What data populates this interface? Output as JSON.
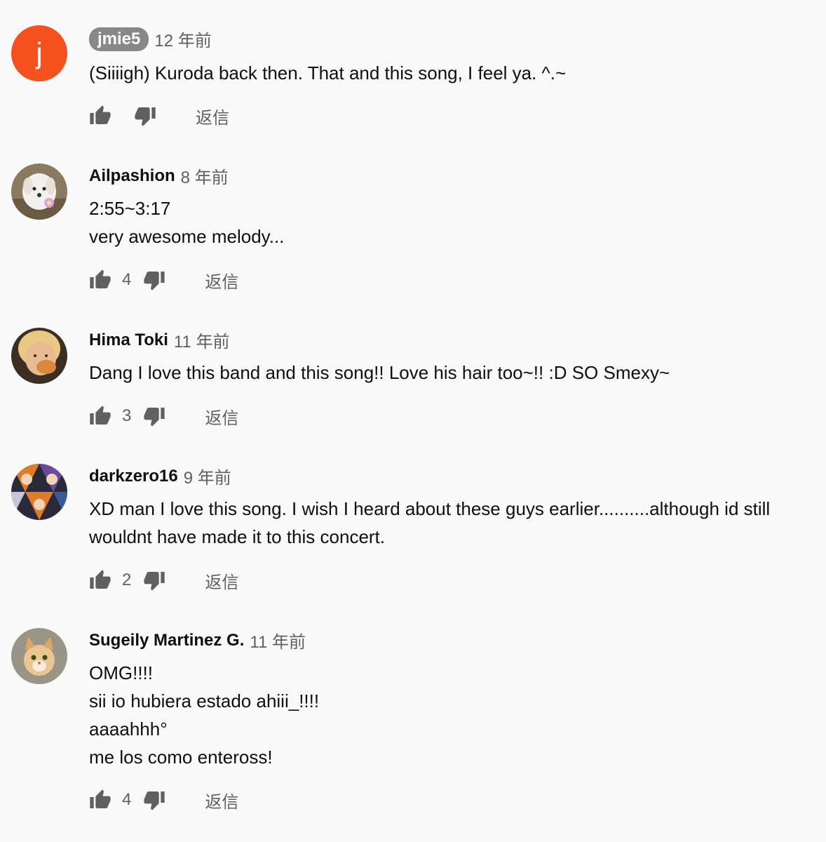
{
  "comments": [
    {
      "author": "jmie5",
      "author_highlighted": true,
      "avatar_letter": "j",
      "avatar_color": "#f4511e",
      "time": "12 年前",
      "body": "(Siiiigh) Kuroda back then.  That and this song, I feel ya. ^.~",
      "likes": "",
      "reply_label": "返信"
    },
    {
      "author": "Ailpashion",
      "author_highlighted": false,
      "avatar_icon": "dog-photo-avatar",
      "time": "8 年前",
      "body": "2:55~3:17\nvery awesome melody...",
      "likes": "4",
      "reply_label": "返信"
    },
    {
      "author": "Hima Toki",
      "author_highlighted": false,
      "avatar_icon": "person-photo-avatar",
      "time": "11 年前",
      "body": "Dang I love this band and this song!! Love his hair too~!! :D SO Smexy~",
      "likes": "3",
      "reply_label": "返信"
    },
    {
      "author": "darkzero16",
      "author_highlighted": false,
      "avatar_icon": "anime-collage-avatar",
      "time": "9 年前",
      "body": "XD man I love this song. I wish I heard about these guys earlier..........although id still wouldnt have made  it to this concert.",
      "likes": "2",
      "reply_label": "返信"
    },
    {
      "author": "Sugeily Martinez G.",
      "author_highlighted": false,
      "avatar_icon": "cat-photo-avatar",
      "time": "11 年前",
      "body": "OMG!!!!\nsii io hubiera estado ahiii_!!!!\naaaahhh°\nme los como enteross!",
      "likes": "4",
      "reply_label": "返信"
    }
  ],
  "colors": {
    "background": "#f9f9f9",
    "text_primary": "#0f0f0f",
    "text_secondary": "#606060",
    "icon": "#606060"
  }
}
